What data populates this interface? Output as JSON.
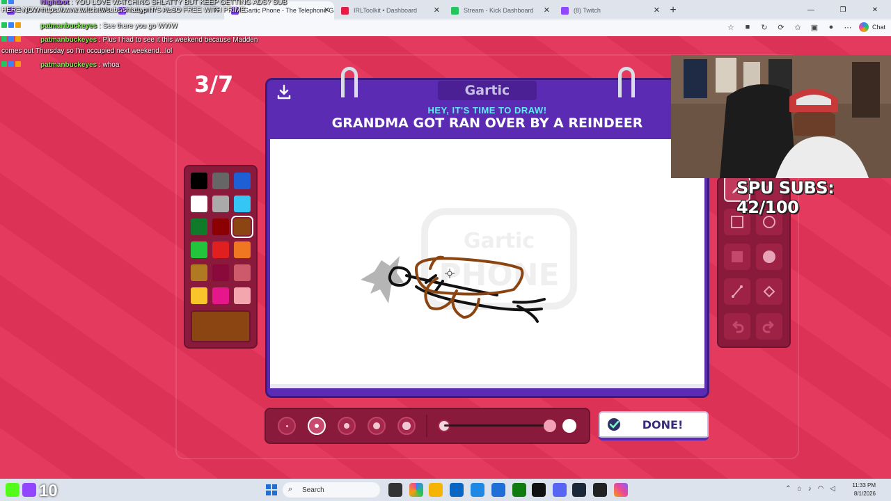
{
  "browser": {
    "tabs": [
      {
        "label": "Nightbot: YOU LOVE WATCHING SHLATTY BUT KEEP GETTING ADS? SUB HERE NOW",
        "favicon_color": "#7c3aed",
        "active": false
      },
      {
        "label": "daaydiorr - Twitch",
        "favicon_color": "#9146ff",
        "active": false
      },
      {
        "label": "Gartic Phone - The Telephone Gam",
        "favicon_color": "#7c3aed",
        "active": true
      },
      {
        "label": "IRLToolkit • Dashboard",
        "favicon_color": "#e11d48",
        "active": false
      },
      {
        "label": "Stream - Kick Dashboard",
        "favicon_color": "#22c55e",
        "active": false
      },
      {
        "label": "(8) Twitch",
        "favicon_color": "#9146ff",
        "active": false
      }
    ],
    "chat_button": "Chat"
  },
  "chat": [
    {
      "user": "Nightbot",
      "text": "YOU LOVE WATCHING SHLATTY BUT KEEP GETTING ADS? SUB HERE NOW https://www.twitch.tv/subs/shlattyp IT'S ALSO FREE WITH PRIME"
    },
    {
      "user": "patmanbuckeyes",
      "text": "See there you go WWW"
    },
    {
      "user": "patmanbuckeyes",
      "text": "Plus I had to see it this weekend because Madden"
    },
    {
      "user": "",
      "text": "comes out Thursday so I'm occupied next weekend...lol"
    },
    {
      "user": "patmanbuckeyes",
      "text": "whoa"
    }
  ],
  "game": {
    "round": "3/7",
    "logo": "Gartic",
    "time_message": "HEY, IT'S TIME TO DRAW!",
    "prompt": "GRANDMA GOT RAN OVER BY A REINDEER",
    "done_label": "DONE!",
    "palette": [
      "#000000",
      "#666666",
      "#1f5fd6",
      "#ffffff",
      "#aaaaaa",
      "#34c7f5",
      "#0e7a2a",
      "#8b0000",
      "#8b4513",
      "#22c43c",
      "#e01f1f",
      "#f07722",
      "#b07a22",
      "#8b0a3c",
      "#cc5a6a",
      "#f8c52a",
      "#e5178a",
      "#f3a6ad"
    ],
    "selected_color": "#8b4513",
    "tools": [
      "pen-icon",
      "eraser-icon",
      "square-outline-icon",
      "circle-outline-icon",
      "square-fill-icon",
      "circle-fill-icon",
      "line-icon",
      "bucket-icon",
      "undo-icon",
      "redo-icon"
    ],
    "brush_sizes": 5,
    "selected_brush": 2
  },
  "stream": {
    "subs_label": "SPU SUBS: 42/100"
  },
  "taskbar": {
    "search_placeholder": "Search",
    "time": "11:33 PM",
    "date": "8/1/2026",
    "overlay_number": "10"
  }
}
